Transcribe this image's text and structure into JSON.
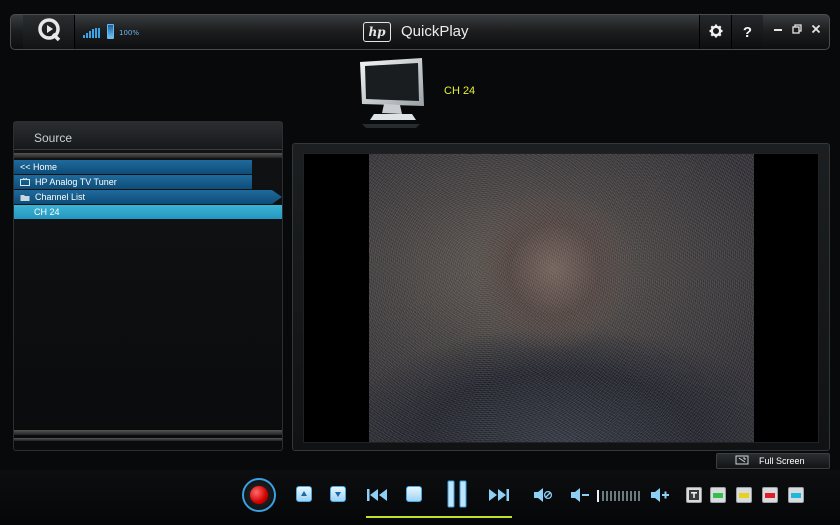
{
  "app": {
    "title": "QuickPlay",
    "brand": "hp"
  },
  "status": {
    "battery": "100%"
  },
  "channel": {
    "name": "CH 24"
  },
  "source": {
    "title": "Source",
    "items": [
      {
        "label": "<< Home"
      },
      {
        "label": "HP Analog TV Tuner"
      },
      {
        "label": "Channel List"
      },
      {
        "label": "CH 24"
      }
    ]
  },
  "video": {
    "fullscreen_label": "Full Screen"
  },
  "controls": {
    "colors": {
      "accent": "#39a4e8",
      "record": "#e00000",
      "progress": "#c8df2a",
      "channel_text": "#e6ef34",
      "selected_row": "#2fa6cb",
      "row": "#17608f"
    },
    "color_buttons": [
      "#444444",
      "#33c04a",
      "#e8d21c",
      "#e01f2a",
      "#20b8d8"
    ]
  }
}
